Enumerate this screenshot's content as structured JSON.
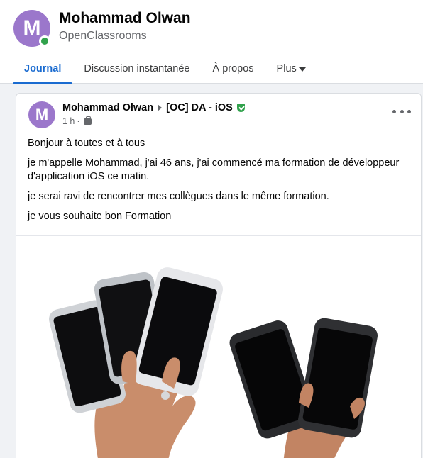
{
  "profile": {
    "avatar_letter": "M",
    "name": "Mohammad Olwan",
    "subtitle": "OpenClassrooms",
    "online_color": "#31a24c",
    "avatar_color": "#9b77cb"
  },
  "tabs": [
    {
      "label": "Journal",
      "active": true
    },
    {
      "label": "Discussion instantanée",
      "active": false
    },
    {
      "label": "À propos",
      "active": false
    },
    {
      "label": "Plus",
      "active": false
    }
  ],
  "post": {
    "avatar_letter": "M",
    "author": "Mohammad Olwan",
    "group": "[OC] DA - iOS",
    "time": "1 h",
    "paragraphs": [
      "Bonjour à toutes et à tous",
      "je m'appelle Mohammad, j'ai 46 ans, j'ai commencé ma formation de développeur d'application iOS ce matin.",
      "je serai ravi de rencontrer mes collègues dans le même formation.",
      "je vous souhaite bon Formation"
    ],
    "image_description_icons": [
      "shield-icon",
      "group-privacy-icon",
      "more-options-icon",
      "dropdown-caret-icon"
    ]
  },
  "colors": {
    "accent": "#1a6bd0",
    "muted_text": "#65676b",
    "verified": "#31a24c"
  }
}
